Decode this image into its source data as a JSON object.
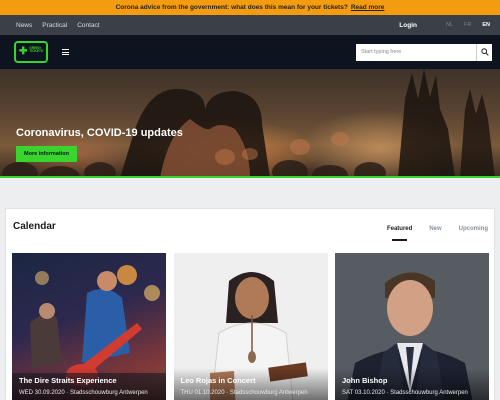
{
  "banner": {
    "text": "Corona advice from the government: what does this mean for your tickets?",
    "link": "Read more"
  },
  "utility_nav": {
    "items": [
      "News",
      "Practical",
      "Contact"
    ],
    "login": "Login",
    "languages": [
      "NL",
      "FR",
      "EN"
    ],
    "active_language": "EN"
  },
  "header": {
    "logo_text": "GREEN TICKETS",
    "search_placeholder": "Start typing here"
  },
  "hero": {
    "title": "Coronavirus, COVID-19 updates",
    "button": "More information"
  },
  "calendar": {
    "title": "Calendar",
    "tabs": [
      "Featured",
      "New",
      "Upcoming"
    ],
    "active_tab": "Featured",
    "events": [
      {
        "name": "The Dire Straits Experience",
        "date": "WED 30.09.2020",
        "venue": "Stadsschouwburg Antwerpen"
      },
      {
        "name": "Leo Rojas in Concert",
        "date": "THU 01.10.2020",
        "venue": "Stadsschouwburg Antwerpen"
      },
      {
        "name": "John Bishop",
        "date": "SAT 03.10.2020",
        "venue": "Stadsschouwburg Antwerpen"
      }
    ]
  },
  "colors": {
    "accent": "#39d42e",
    "banner": "#f39c12",
    "header_dark": "#0d1420",
    "utility_bar": "#3b4048"
  }
}
